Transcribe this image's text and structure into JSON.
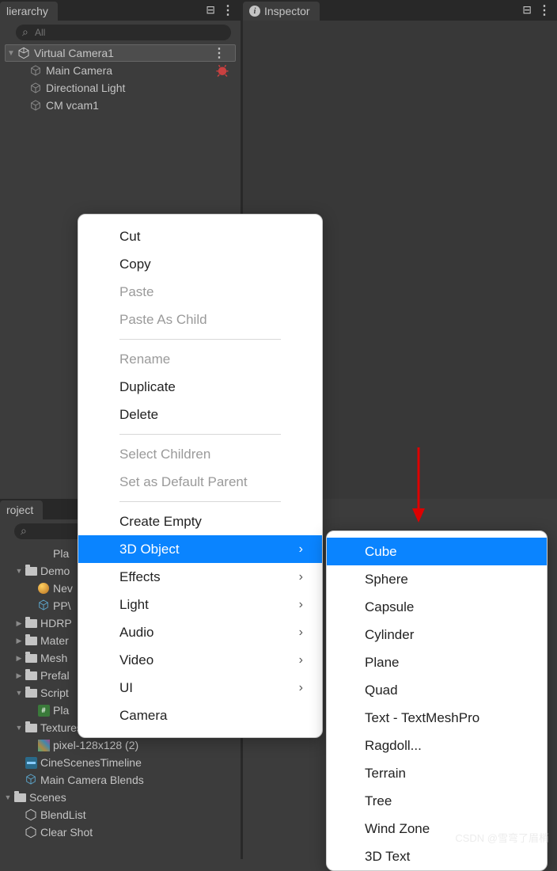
{
  "hierarchy": {
    "tab_label": "lierarchy",
    "search_placeholder": "All",
    "scene_name": "Virtual Camera1",
    "items": [
      {
        "label": "Main Camera"
      },
      {
        "label": "Directional Light"
      },
      {
        "label": "CM vcam1"
      }
    ]
  },
  "inspector": {
    "tab_label": "Inspector"
  },
  "project": {
    "tab_label": "roject",
    "items": [
      {
        "label": "Pla",
        "pad": 2,
        "icon": "cube-outline",
        "arrow": ""
      },
      {
        "label": "Demo",
        "pad": 1,
        "icon": "folder",
        "arrow": "down"
      },
      {
        "label": "Nev",
        "pad": 2,
        "icon": "sphere",
        "arrow": ""
      },
      {
        "label": "PP\\",
        "pad": 2,
        "icon": "blue-cube",
        "arrow": ""
      },
      {
        "label": "HDRP",
        "pad": 1,
        "icon": "folder",
        "arrow": "right"
      },
      {
        "label": "Mater",
        "pad": 1,
        "icon": "folder",
        "arrow": "right"
      },
      {
        "label": "Mesh",
        "pad": 1,
        "icon": "folder",
        "arrow": "right"
      },
      {
        "label": "Prefal",
        "pad": 1,
        "icon": "folder",
        "arrow": "right"
      },
      {
        "label": "Script",
        "pad": 1,
        "icon": "folder",
        "arrow": "down"
      },
      {
        "label": "Pla",
        "pad": 2,
        "icon": "cs",
        "arrow": ""
      },
      {
        "label": "Textures",
        "pad": 1,
        "icon": "folder",
        "arrow": "down"
      },
      {
        "label": "pixel-128x128 (2)",
        "pad": 2,
        "icon": "pixel",
        "arrow": ""
      },
      {
        "label": "CineScenesTimeline",
        "pad": 1,
        "icon": "timeline",
        "arrow": ""
      },
      {
        "label": "Main Camera Blends",
        "pad": 1,
        "icon": "blend",
        "arrow": ""
      },
      {
        "label": "Scenes",
        "pad": 0,
        "icon": "folder",
        "arrow": "down"
      },
      {
        "label": "BlendList",
        "pad": 1,
        "icon": "unity",
        "arrow": ""
      },
      {
        "label": "Clear Shot",
        "pad": 1,
        "icon": "unity",
        "arrow": ""
      }
    ]
  },
  "context_menu": {
    "items": [
      {
        "label": "Cut",
        "type": "item"
      },
      {
        "label": "Copy",
        "type": "item"
      },
      {
        "label": "Paste",
        "type": "item",
        "disabled": true
      },
      {
        "label": "Paste As Child",
        "type": "item",
        "disabled": true
      },
      {
        "type": "sep"
      },
      {
        "label": "Rename",
        "type": "item",
        "disabled": true
      },
      {
        "label": "Duplicate",
        "type": "item"
      },
      {
        "label": "Delete",
        "type": "item"
      },
      {
        "type": "sep"
      },
      {
        "label": "Select Children",
        "type": "item",
        "disabled": true
      },
      {
        "label": "Set as Default Parent",
        "type": "item",
        "disabled": true
      },
      {
        "type": "sep"
      },
      {
        "label": "Create Empty",
        "type": "item"
      },
      {
        "label": "3D Object",
        "type": "item",
        "submenu": true,
        "highlight": true
      },
      {
        "label": "Effects",
        "type": "item",
        "submenu": true
      },
      {
        "label": "Light",
        "type": "item",
        "submenu": true
      },
      {
        "label": "Audio",
        "type": "item",
        "submenu": true
      },
      {
        "label": "Video",
        "type": "item",
        "submenu": true
      },
      {
        "label": "UI",
        "type": "item",
        "submenu": true
      },
      {
        "label": "Camera",
        "type": "item"
      }
    ]
  },
  "submenu": {
    "items": [
      {
        "label": "Cube",
        "highlight": true
      },
      {
        "label": "Sphere"
      },
      {
        "label": "Capsule"
      },
      {
        "label": "Cylinder"
      },
      {
        "label": "Plane"
      },
      {
        "label": "Quad"
      },
      {
        "label": "Text - TextMeshPro"
      },
      {
        "label": "Ragdoll..."
      },
      {
        "label": "Terrain"
      },
      {
        "label": "Tree"
      },
      {
        "label": "Wind Zone"
      },
      {
        "label": "3D Text"
      }
    ]
  },
  "watermark": "CSDN @雪弯了眉梢"
}
